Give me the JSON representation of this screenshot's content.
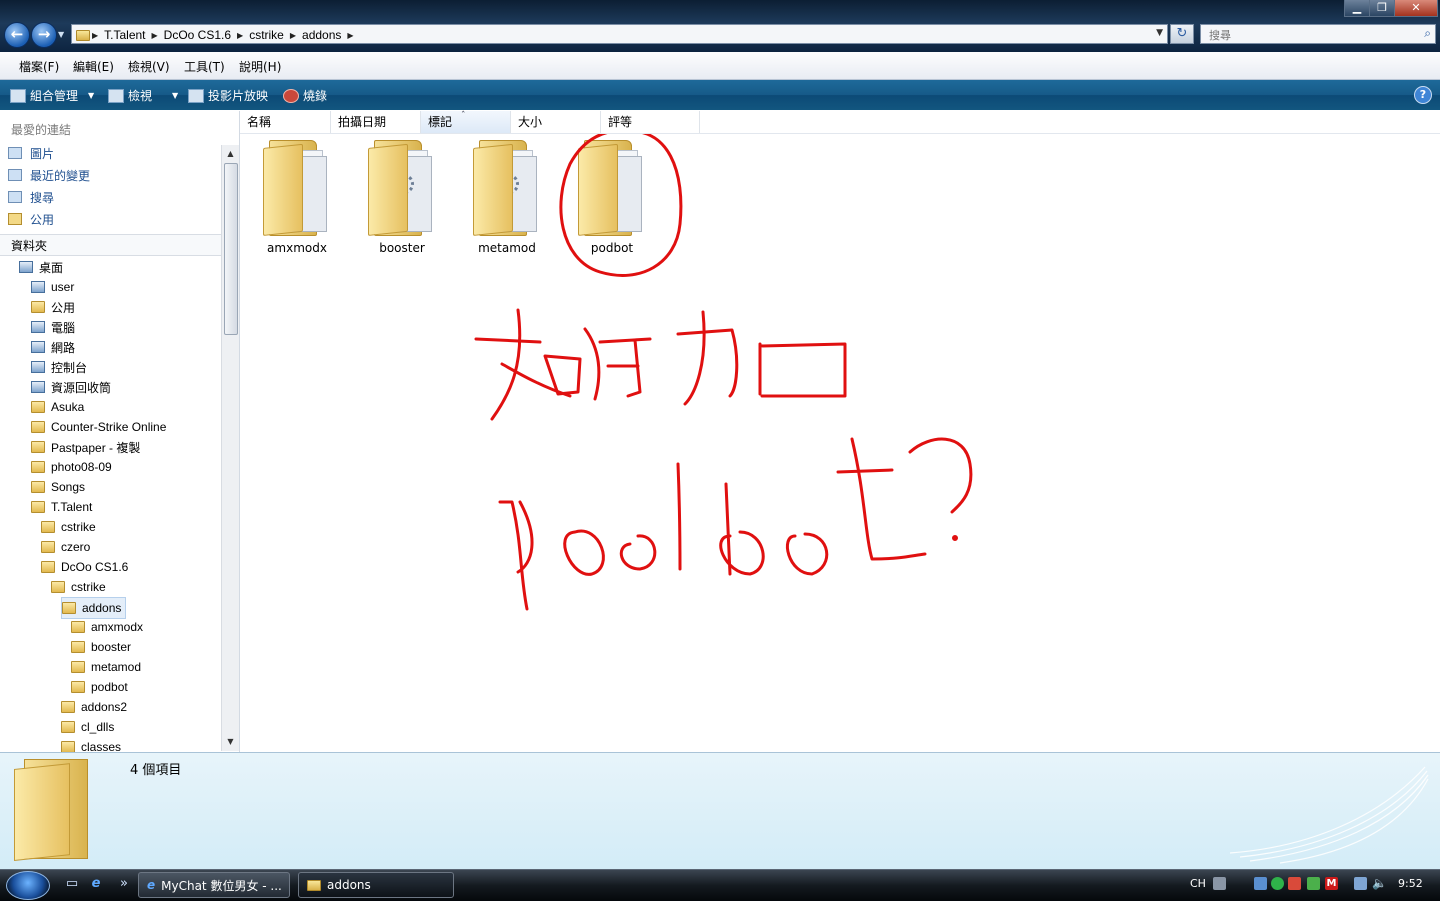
{
  "window": {
    "buttons": {
      "minimize": "▁",
      "maximize": "❐",
      "close": "✕"
    }
  },
  "nav": {
    "back_icon": "back-arrow-icon",
    "forward_icon": "forward-arrow-icon",
    "back": "←",
    "forward": "→"
  },
  "address": {
    "crumbs": [
      "T.Talent",
      "DcOo CS1.6",
      "cstrike",
      "addons"
    ]
  },
  "search": {
    "placeholder": "搜尋"
  },
  "menu": [
    "檔案(F)",
    "編輯(E)",
    "檢視(V)",
    "工具(T)",
    "說明(H)"
  ],
  "toolbar": {
    "organize": "組合管理",
    "views": "檢視",
    "slideshow": "投影片放映",
    "burn": "燒錄",
    "help": "?"
  },
  "navpane": {
    "favorites_title": "最愛的連結",
    "favorites": [
      "圖片",
      "最近的變更",
      "搜尋",
      "公用"
    ],
    "folders_title": "資料夾",
    "tree": [
      {
        "label": "桌面",
        "level": 0,
        "type": "sys"
      },
      {
        "label": "user",
        "level": 1,
        "type": "sys"
      },
      {
        "label": "公用",
        "level": 1,
        "type": "folder"
      },
      {
        "label": "電腦",
        "level": 1,
        "type": "sys"
      },
      {
        "label": "網路",
        "level": 1,
        "type": "sys"
      },
      {
        "label": "控制台",
        "level": 1,
        "type": "sys"
      },
      {
        "label": "資源回收筒",
        "level": 1,
        "type": "sys"
      },
      {
        "label": "Asuka",
        "level": 1,
        "type": "folder"
      },
      {
        "label": "Counter-Strike Online",
        "level": 1,
        "type": "folder"
      },
      {
        "label": "Pastpaper - 複製",
        "level": 1,
        "type": "folder"
      },
      {
        "label": "photo08-09",
        "level": 1,
        "type": "folder"
      },
      {
        "label": "Songs",
        "level": 1,
        "type": "folder"
      },
      {
        "label": "T.Talent",
        "level": 1,
        "type": "folder"
      },
      {
        "label": "cstrike",
        "level": 2,
        "type": "folder"
      },
      {
        "label": "czero",
        "level": 2,
        "type": "folder"
      },
      {
        "label": "DcOo CS1.6",
        "level": 2,
        "type": "folder"
      },
      {
        "label": "cstrike",
        "level": 3,
        "type": "folder"
      },
      {
        "label": "addons",
        "level": 4,
        "type": "folder",
        "selected": true
      },
      {
        "label": "amxmodx",
        "level": 5,
        "type": "folder"
      },
      {
        "label": "booster",
        "level": 5,
        "type": "folder"
      },
      {
        "label": "metamod",
        "level": 5,
        "type": "folder"
      },
      {
        "label": "podbot",
        "level": 5,
        "type": "folder"
      },
      {
        "label": "addons2",
        "level": 4,
        "type": "folder"
      },
      {
        "label": "cl_dlls",
        "level": 4,
        "type": "folder"
      },
      {
        "label": "classes",
        "level": 4,
        "type": "folder"
      }
    ]
  },
  "columns": [
    "名稱",
    "拍攝日期",
    "標記",
    "大小",
    "評等"
  ],
  "items": [
    {
      "name": "amxmodx",
      "icon": "folder-icon"
    },
    {
      "name": "booster",
      "icon": "folder-icon"
    },
    {
      "name": "metamod",
      "icon": "folder-icon"
    },
    {
      "name": "podbot",
      "icon": "folder-icon"
    }
  ],
  "details": {
    "count": "4 個項目"
  },
  "taskbar": {
    "tasks": [
      "MyChat 數位男女 - ...",
      "addons"
    ],
    "lang": "CH",
    "clock": "9:52",
    "more": "»"
  },
  "annotation_color": "#e01010"
}
